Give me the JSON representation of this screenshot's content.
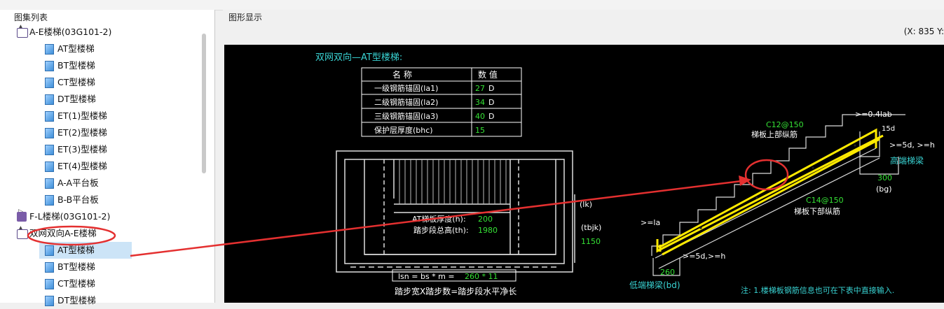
{
  "panels": {
    "left_title": "图集列表",
    "right_title": "图形显示"
  },
  "coords": "(X: 835 Y:",
  "tree": [
    {
      "label": "A-E楼梯(03G101-2)",
      "level": 0,
      "icon": "book-open-icon",
      "expander": "▲"
    },
    {
      "label": "AT型楼梯",
      "level": 1,
      "icon": "page-icon"
    },
    {
      "label": "BT型楼梯",
      "level": 1,
      "icon": "page-icon"
    },
    {
      "label": "CT型楼梯",
      "level": 1,
      "icon": "page-icon"
    },
    {
      "label": "DT型楼梯",
      "level": 1,
      "icon": "page-icon"
    },
    {
      "label": "ET(1)型楼梯",
      "level": 1,
      "icon": "page-icon"
    },
    {
      "label": "ET(2)型楼梯",
      "level": 1,
      "icon": "page-icon"
    },
    {
      "label": "ET(3)型楼梯",
      "level": 1,
      "icon": "page-icon"
    },
    {
      "label": "ET(4)型楼梯",
      "level": 1,
      "icon": "page-icon"
    },
    {
      "label": "A-A平台板",
      "level": 1,
      "icon": "page-icon"
    },
    {
      "label": "B-B平台板",
      "level": 1,
      "icon": "page-icon"
    },
    {
      "label": "F-L楼梯(03G101-2)",
      "level": 0,
      "icon": "book-closed-icon",
      "expander": "▷"
    },
    {
      "label": "双网双向A-E楼梯",
      "level": 0,
      "icon": "book-open-icon",
      "expander": "▲"
    },
    {
      "label": "AT型楼梯",
      "level": 1,
      "icon": "page-icon",
      "selected": true
    },
    {
      "label": "BT型楼梯",
      "level": 1,
      "icon": "page-icon"
    },
    {
      "label": "CT型楼梯",
      "level": 1,
      "icon": "page-icon"
    },
    {
      "label": "DT型楼梯",
      "level": 1,
      "icon": "page-icon"
    }
  ],
  "drawing": {
    "title": "双网双向—AT型楼梯:",
    "table_headers": [
      "名 称",
      "数 值"
    ],
    "table_rows": [
      {
        "name": "一级钢筋锚固(la1)",
        "value": "27",
        "unit": "D"
      },
      {
        "name": "二级钢筋锚固(la2)",
        "value": "34",
        "unit": "D"
      },
      {
        "name": "三级钢筋锚固(la3)",
        "value": "40",
        "unit": "D"
      },
      {
        "name": "保护层厚度(bhc)",
        "value": "15",
        "unit": ""
      }
    ],
    "plan_text1_label": "AT梯板厚度(h):",
    "plan_text1_value": "200",
    "plan_text2_label": "踏步段总高(th):",
    "plan_text2_value": "1980",
    "dim_lk": "(lk)",
    "dim_tbjk": "(tbjk)",
    "dim_1150": "1150",
    "formula_left": "lsn = bs * m = ",
    "formula_value": "260 * 11",
    "formula_note": "踏步宽X踏步数=踏步段水平净长",
    "c12": "C12@150",
    "upper_bar": "梯板上部纵筋",
    "c14": "C14@150",
    "lower_bar": "梯板下部纵筋",
    "anchor_top": ">=0.4lab",
    "d15": "15d",
    "ge5d_top": ">=5d, >=h",
    "high_beam": "高端梯梁",
    "val_300": "300",
    "bg": "(bg)",
    "la": ">=la",
    "ge5d_bottom": ">=5d,>=h",
    "val_260": "260",
    "low_beam": "低端梯梁(bd)",
    "note": "注: 1.楼梯板钢筋信息也可在下表中直接输入."
  }
}
